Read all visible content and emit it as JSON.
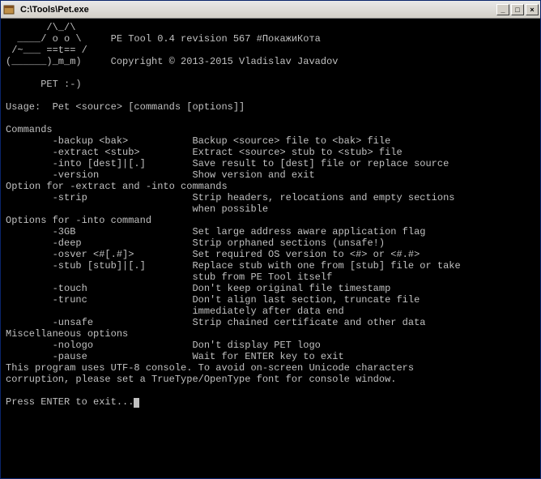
{
  "titlebar": {
    "title": "C:\\Tools\\Pet.exe",
    "min": "_",
    "max": "□",
    "close": "×"
  },
  "ascii": {
    "l1": "       /\\_/\\",
    "l2": "  ____/ o o \\     PE Tool 0.4 revision 567 #ПокажиКота",
    "l3": " /~___ ==t== /",
    "l4": "(______)_m_m)     Copyright © 2013-2015 Vladislav Javadov",
    "l5": "",
    "l6": "      PET :-)"
  },
  "usage": "Usage:  Pet <source> [commands [options]]",
  "sections": {
    "commands": {
      "header": "Commands",
      "items": [
        {
          "flag": "-backup <bak>",
          "desc": "Backup <source> file to <bak> file"
        },
        {
          "flag": "-extract <stub>",
          "desc": "Extract <source> stub to <stub> file"
        },
        {
          "flag": "-into [dest]|[.]",
          "desc": "Save result to [dest] file or replace source"
        },
        {
          "flag": "-version",
          "desc": "Show version and exit"
        }
      ]
    },
    "opt_extract": {
      "header": "Option for -extract and -into commands",
      "items": [
        {
          "flag": "-strip",
          "desc": "Strip headers, relocations and empty sections"
        },
        {
          "flag": "",
          "desc": "when possible"
        }
      ]
    },
    "opt_into": {
      "header": "Options for -into command",
      "items": [
        {
          "flag": "-3GB",
          "desc": "Set large address aware application flag"
        },
        {
          "flag": "-deep",
          "desc": "Strip orphaned sections (unsafe!)"
        },
        {
          "flag": "-osver <#[.#]>",
          "desc": "Set required OS version to <#> or <#.#>"
        },
        {
          "flag": "-stub [stub]|[.]",
          "desc": "Replace stub with one from [stub] file or take"
        },
        {
          "flag": "",
          "desc": "stub from PE Tool itself"
        },
        {
          "flag": "-touch",
          "desc": "Don't keep original file timestamp"
        },
        {
          "flag": "-trunc",
          "desc": "Don't align last section, truncate file"
        },
        {
          "flag": "",
          "desc": "immediately after data end"
        },
        {
          "flag": "-unsafe",
          "desc": "Strip chained certificate and other data"
        }
      ]
    },
    "misc": {
      "header": "Miscellaneous options",
      "items": [
        {
          "flag": "-nologo",
          "desc": "Don't display PET logo"
        },
        {
          "flag": "-pause",
          "desc": "Wait for ENTER key to exit"
        }
      ]
    }
  },
  "footer": {
    "l1": "This program uses UTF-8 console. To avoid on-screen Unicode characters",
    "l2": "corruption, please set a TrueType/OpenType font for console window.",
    "prompt": "Press ENTER to exit..."
  }
}
